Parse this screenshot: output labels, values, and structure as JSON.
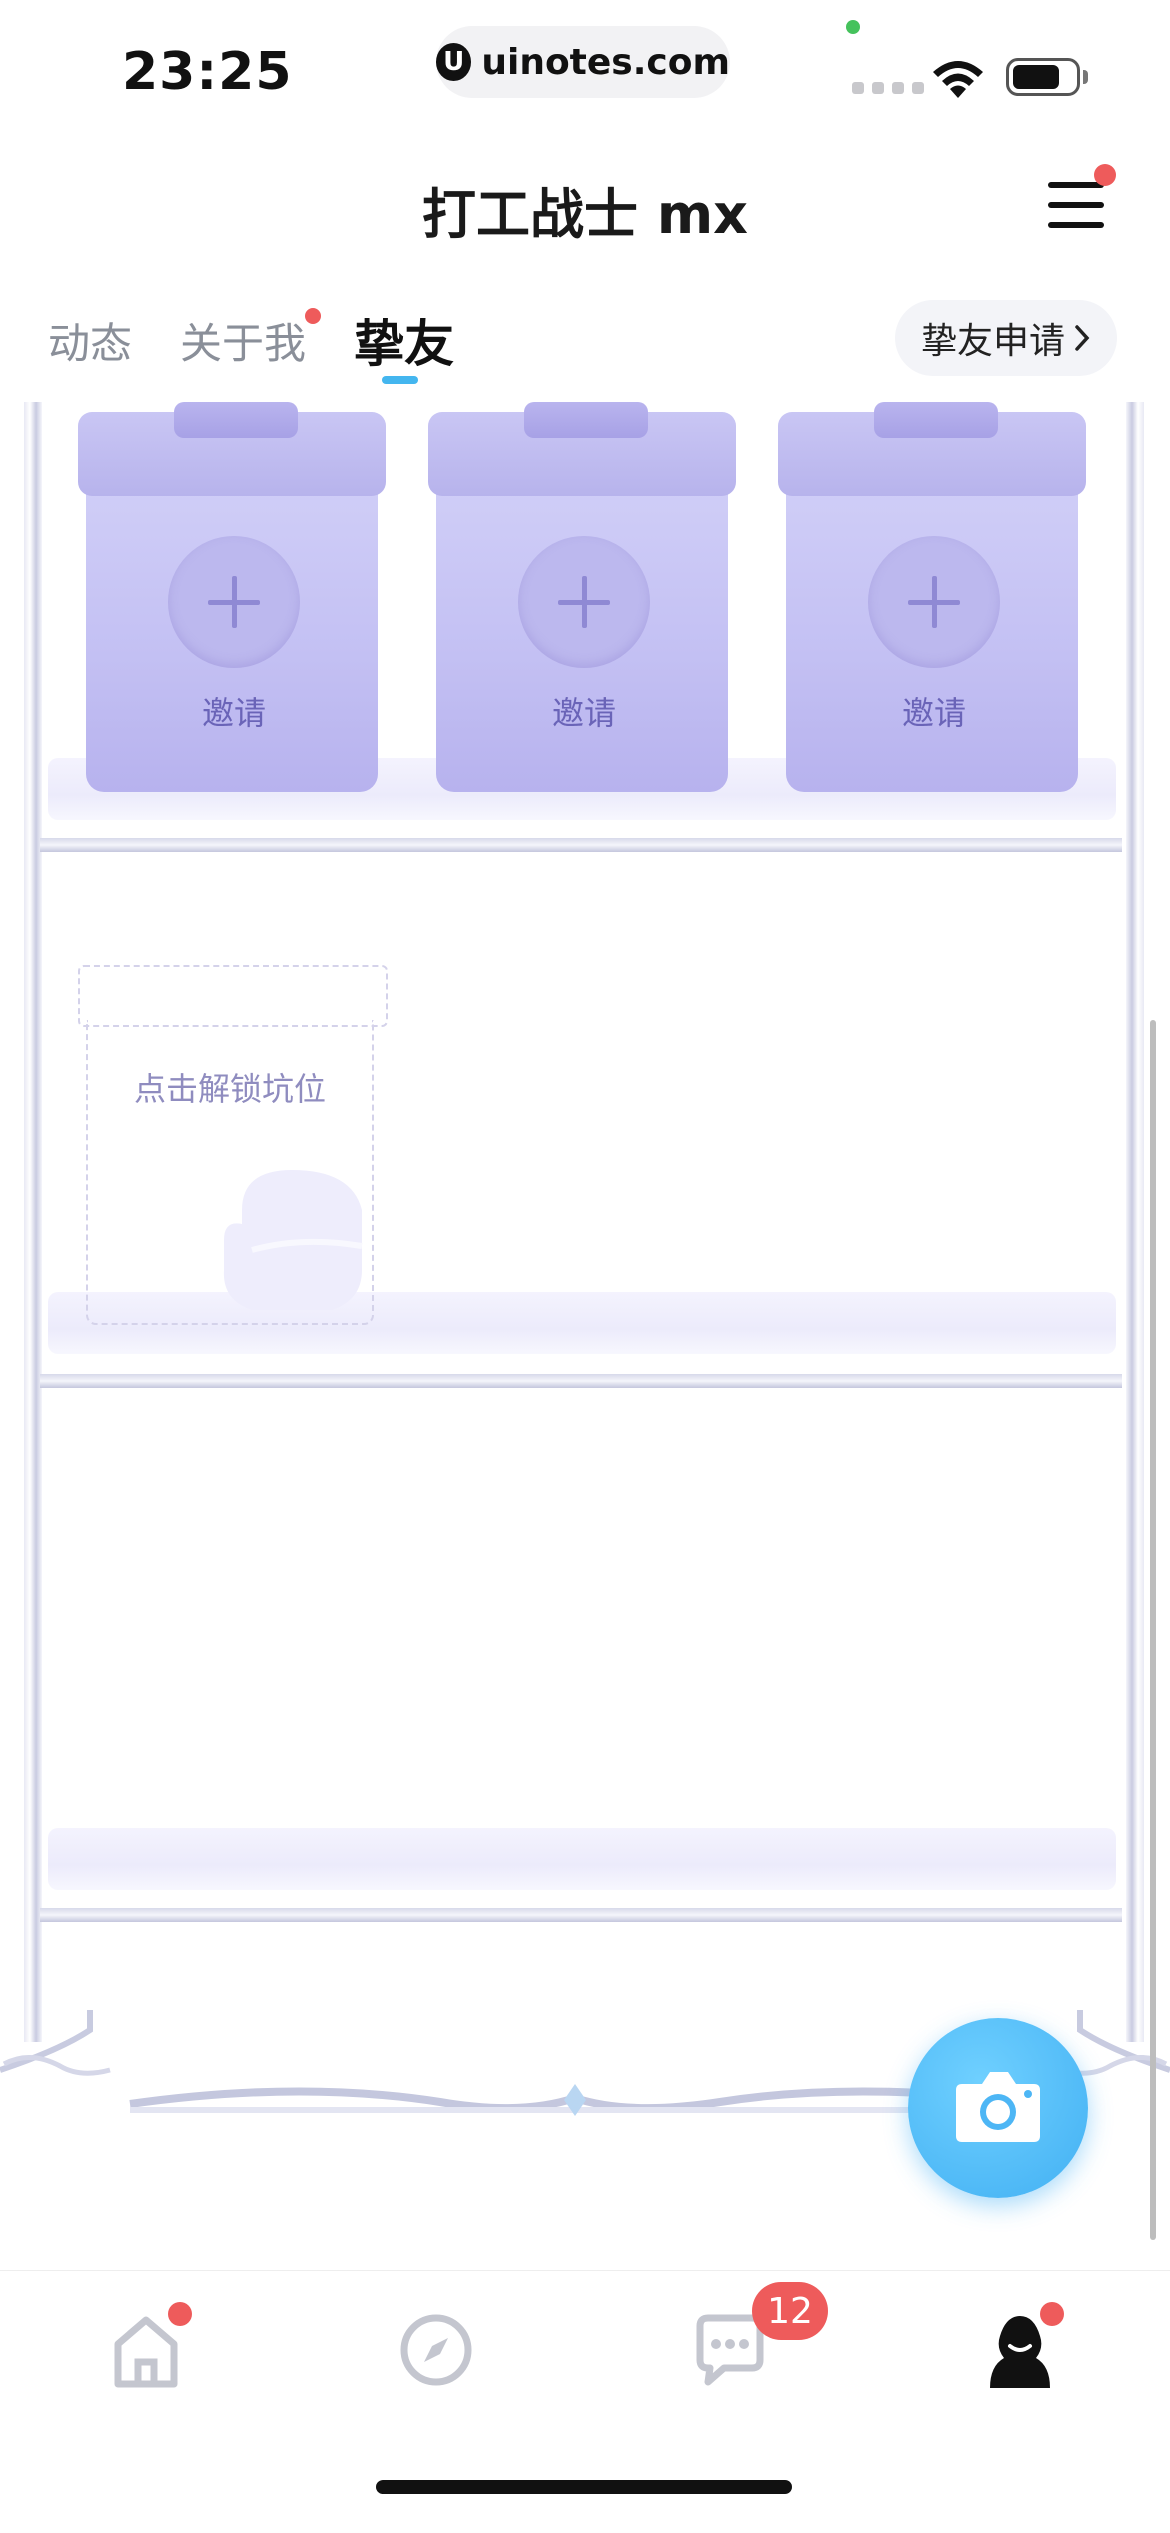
{
  "status_bar": {
    "time": "23:25",
    "url": "uinotes.com",
    "url_icon": "U"
  },
  "header": {
    "title": "打工战士 mx"
  },
  "tabs": [
    {
      "label": "动态",
      "active": false
    },
    {
      "label": "关于我",
      "active": false,
      "has_dot": true
    },
    {
      "label": "挚友",
      "active": true
    }
  ],
  "friend_request_button": {
    "label": "挚友申请",
    "icon": "chevron-right-icon"
  },
  "gift_slots": [
    {
      "label": "邀请",
      "icon": "plus-icon"
    },
    {
      "label": "邀请",
      "icon": "plus-icon"
    },
    {
      "label": "邀请",
      "icon": "plus-icon"
    }
  ],
  "locked_slot": {
    "label": "点击解锁坑位"
  },
  "fab": {
    "icon": "camera-icon"
  },
  "bottom_nav": [
    {
      "name": "home",
      "icon": "home-icon",
      "has_dot": true
    },
    {
      "name": "discover",
      "icon": "compass-icon"
    },
    {
      "name": "messages",
      "icon": "chat-icon",
      "badge": "12"
    },
    {
      "name": "profile",
      "icon": "profile-icon",
      "has_dot": true
    }
  ],
  "colors": {
    "accent": "#44b6ef",
    "badge_red": "#ee5b5b",
    "gift_purple": "#c3c0f3"
  }
}
